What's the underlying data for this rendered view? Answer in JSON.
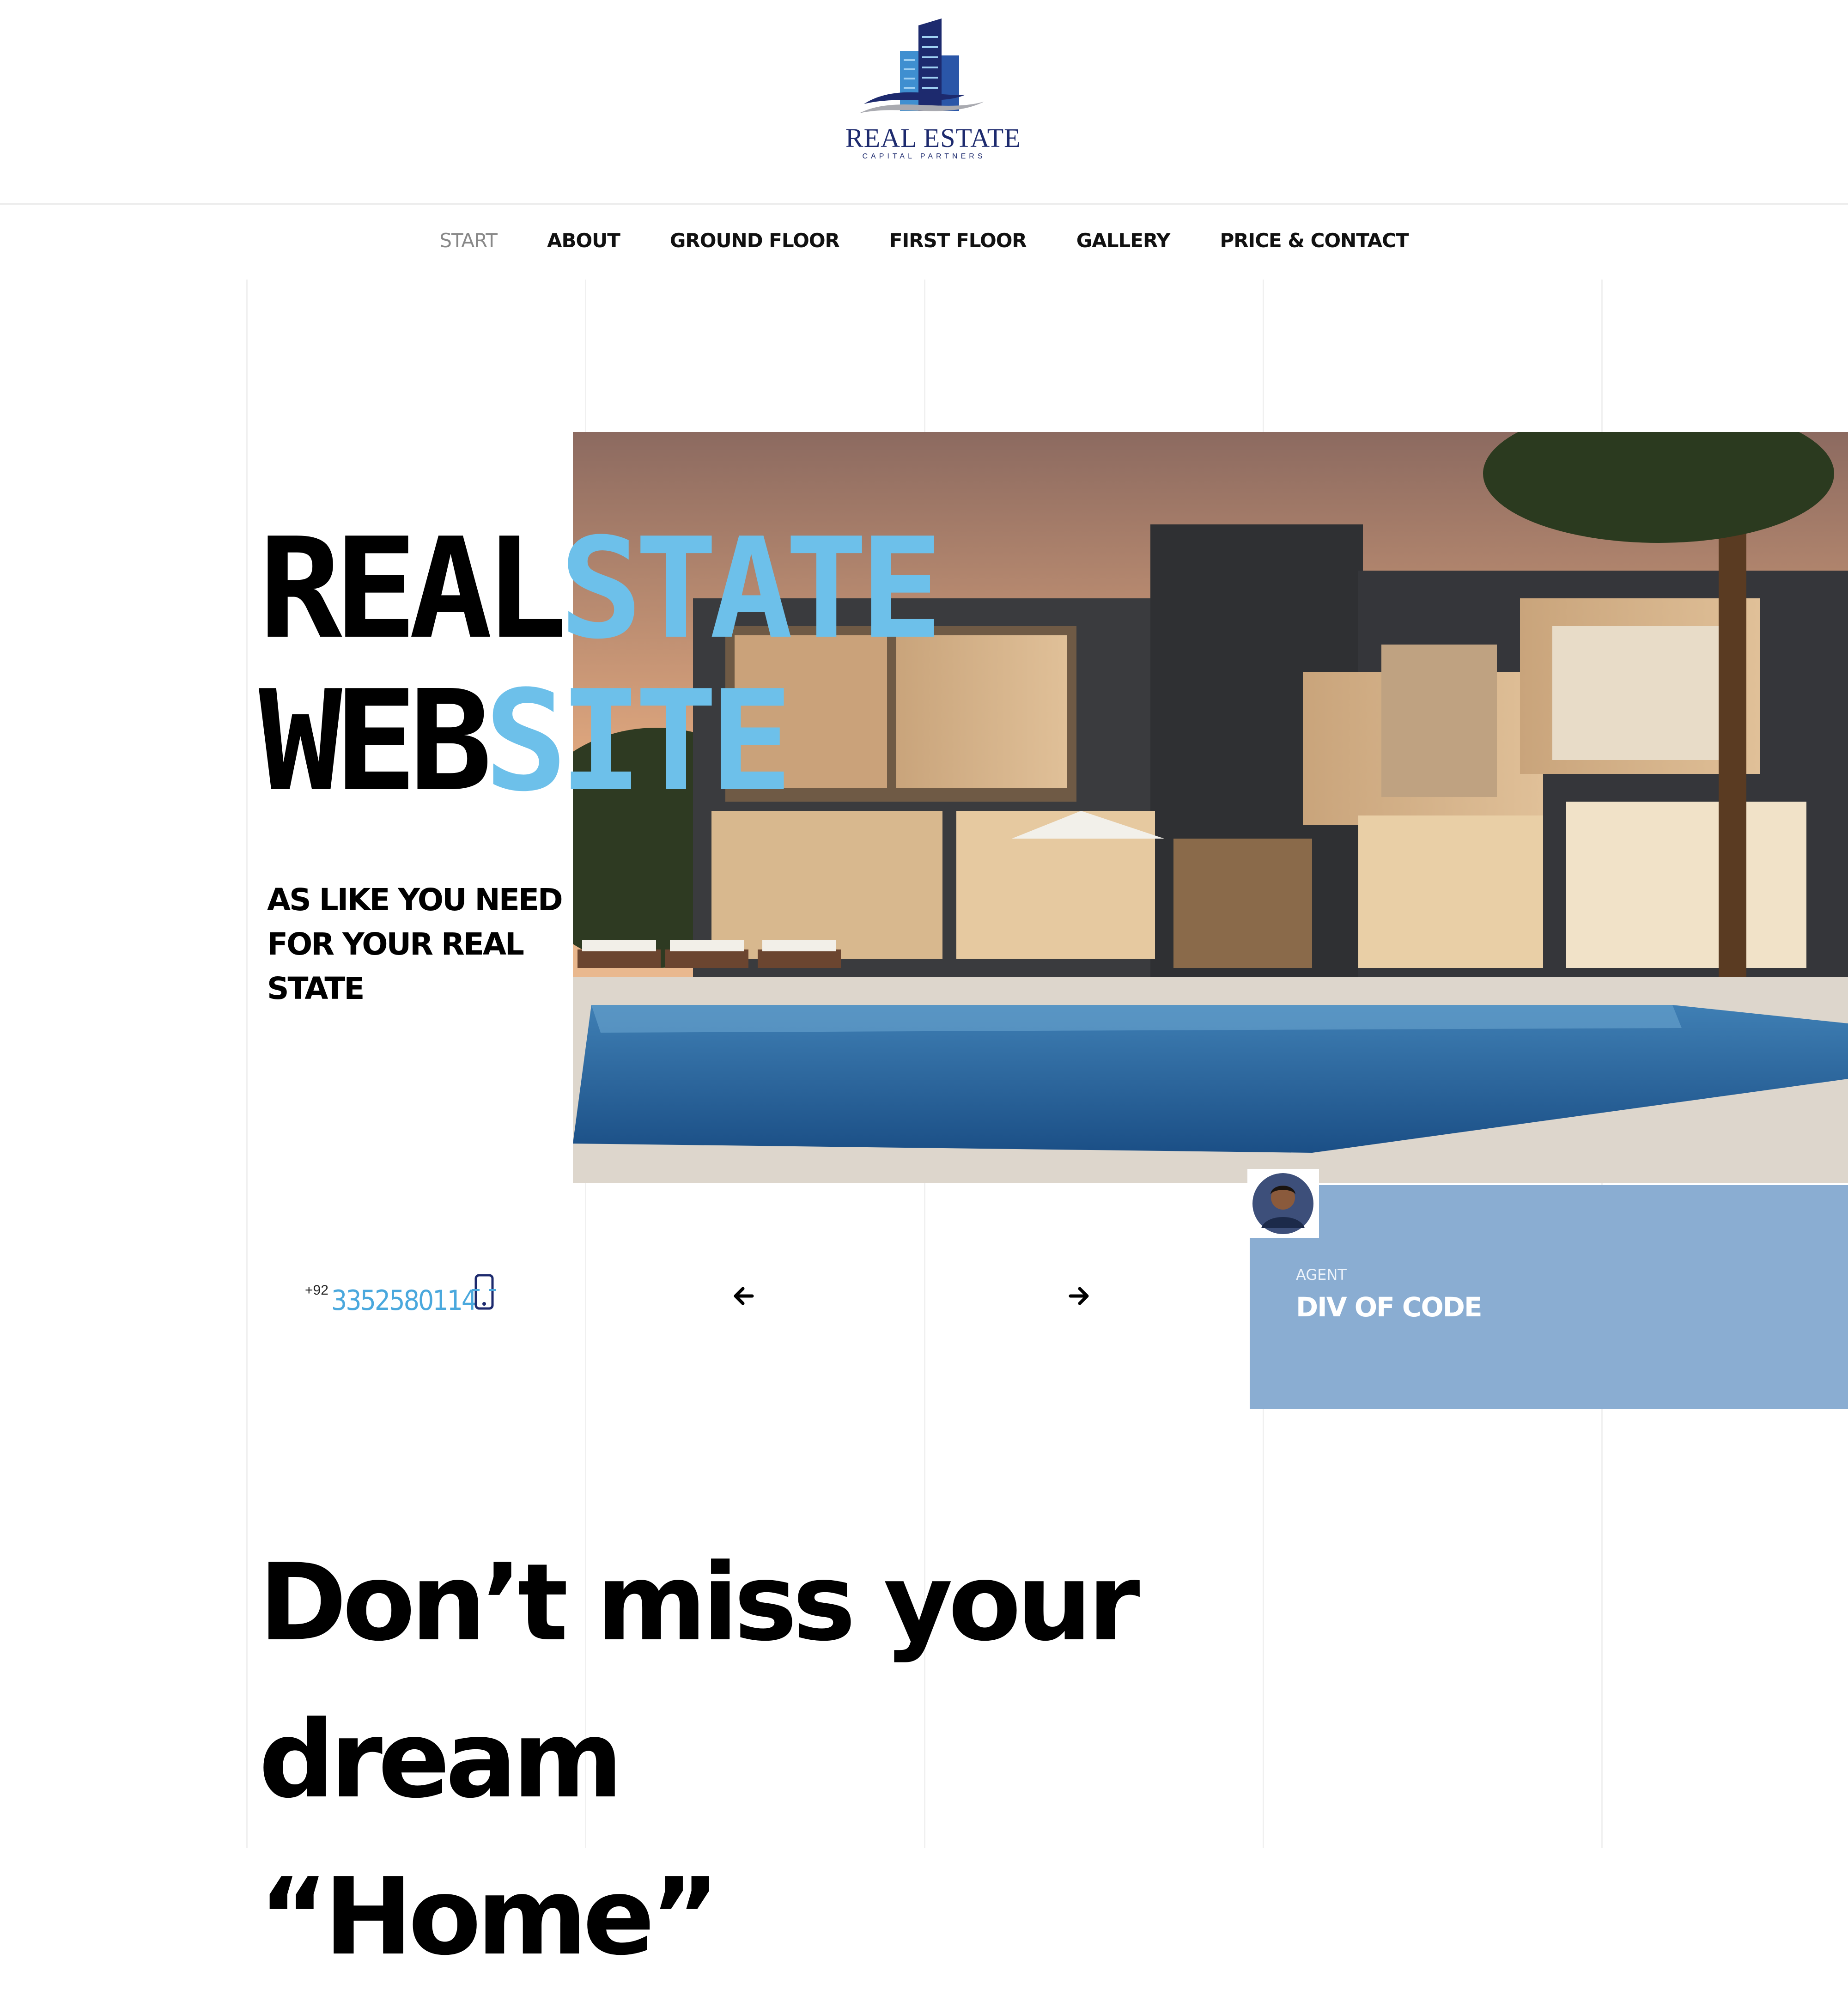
{
  "header": {
    "logo_title": "REAL ESTATE",
    "logo_subtitle": "CAPITAL PARTNERS",
    "colors": {
      "logo_navy": "#1d2a6e",
      "logo_blue": "#3f8fd0"
    }
  },
  "nav": {
    "items": [
      {
        "label": "START",
        "active": true
      },
      {
        "label": "ABOUT",
        "active": false
      },
      {
        "label": "GROUND FLOOR",
        "active": false
      },
      {
        "label": "FIRST FLOOR",
        "active": false
      },
      {
        "label": "GALLERY",
        "active": false
      },
      {
        "label": "PRICE & CONTACT",
        "active": false
      }
    ]
  },
  "hero": {
    "title_line1_dark": "REAL",
    "title_line1_blue": "STATE",
    "title_line2_dark": "WEB",
    "title_line2_blue": "SITE",
    "tagline": "AS LIKE YOU NEED FOR YOUR REAL STATE",
    "accent_color": "#6dc0ea",
    "image_icon": "modern-house-pool-image"
  },
  "contact": {
    "country_code": "+92",
    "phone": "3352580114",
    "phone_icon": "phone-icon"
  },
  "slider": {
    "prev_icon": "arrow-left-icon",
    "next_icon": "arrow-right-icon"
  },
  "agent": {
    "label": "AGENT",
    "name": "DIV OF CODE",
    "card_color": "#8aadd2"
  },
  "cta": {
    "line1": "Don’t miss your dream",
    "line2": "“Home”"
  }
}
